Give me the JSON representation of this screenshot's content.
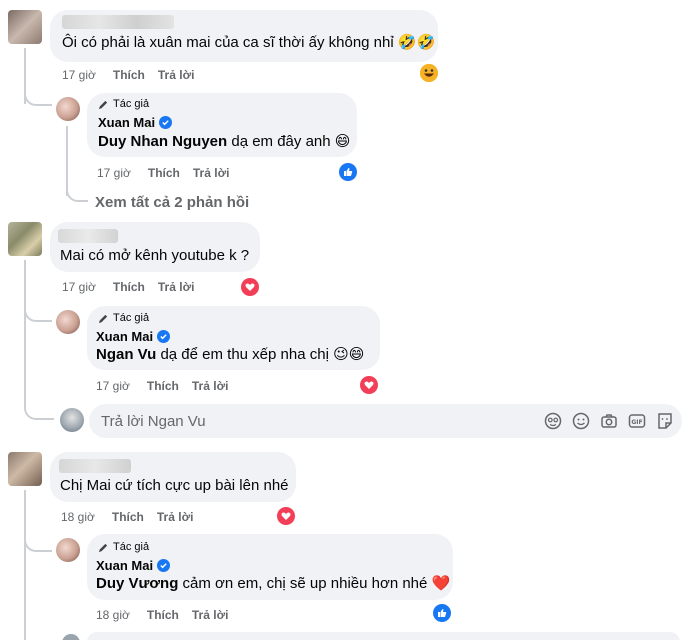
{
  "actions": {
    "like": "Thích",
    "reply": "Trả lời"
  },
  "author_badge": "Tác giả",
  "comments": [
    {
      "text": "Ôi có phải là xuân mai của ca sĩ thời ấy không nhỉ",
      "text_emoji": "🤣🤣",
      "time": "17 giờ",
      "reaction": "haha",
      "reply": {
        "author": "Xuan Mai",
        "mention": "Duy Nhan Nguyen",
        "text": "dạ em đây anh",
        "text_emoji": "😄",
        "time": "17 giờ",
        "reaction": "like"
      },
      "see_all": "Xem tất cả 2 phản hồi"
    },
    {
      "text": "Mai có mở kênh youtube k ?",
      "time": "17 giờ",
      "reaction": "heart",
      "reply": {
        "author": "Xuan Mai",
        "mention": "Ngan Vu",
        "text": "dạ để em thu xếp nha chị",
        "text_emoji": "😉😄",
        "time": "17 giờ",
        "reaction": "heart"
      },
      "reply_input": {
        "placeholder": "Trả lời Ngan Vu"
      }
    },
    {
      "text": "Chị Mai cứ tích cực up bài lên nhé",
      "time": "18 giờ",
      "reaction": "heart",
      "reply": {
        "author": "Xuan Mai",
        "mention": "Duy Vương",
        "text": "cảm ơn em, chị sẽ up nhiều hơn nhé",
        "text_emoji": "❤️",
        "time": "18 giờ",
        "reaction": "like"
      }
    }
  ],
  "icons": {
    "reply_input_icons": [
      "avatar-sticker-icon",
      "emoji-icon",
      "camera-icon",
      "gif-icon",
      "sticker-icon"
    ]
  },
  "colors": {
    "bubble": "#f0f2f5",
    "meta_text": "#65676b",
    "verified": "#1877f2",
    "heart": "#f33e58",
    "like": "#1877f2",
    "thread_line": "#ccd0d5"
  }
}
